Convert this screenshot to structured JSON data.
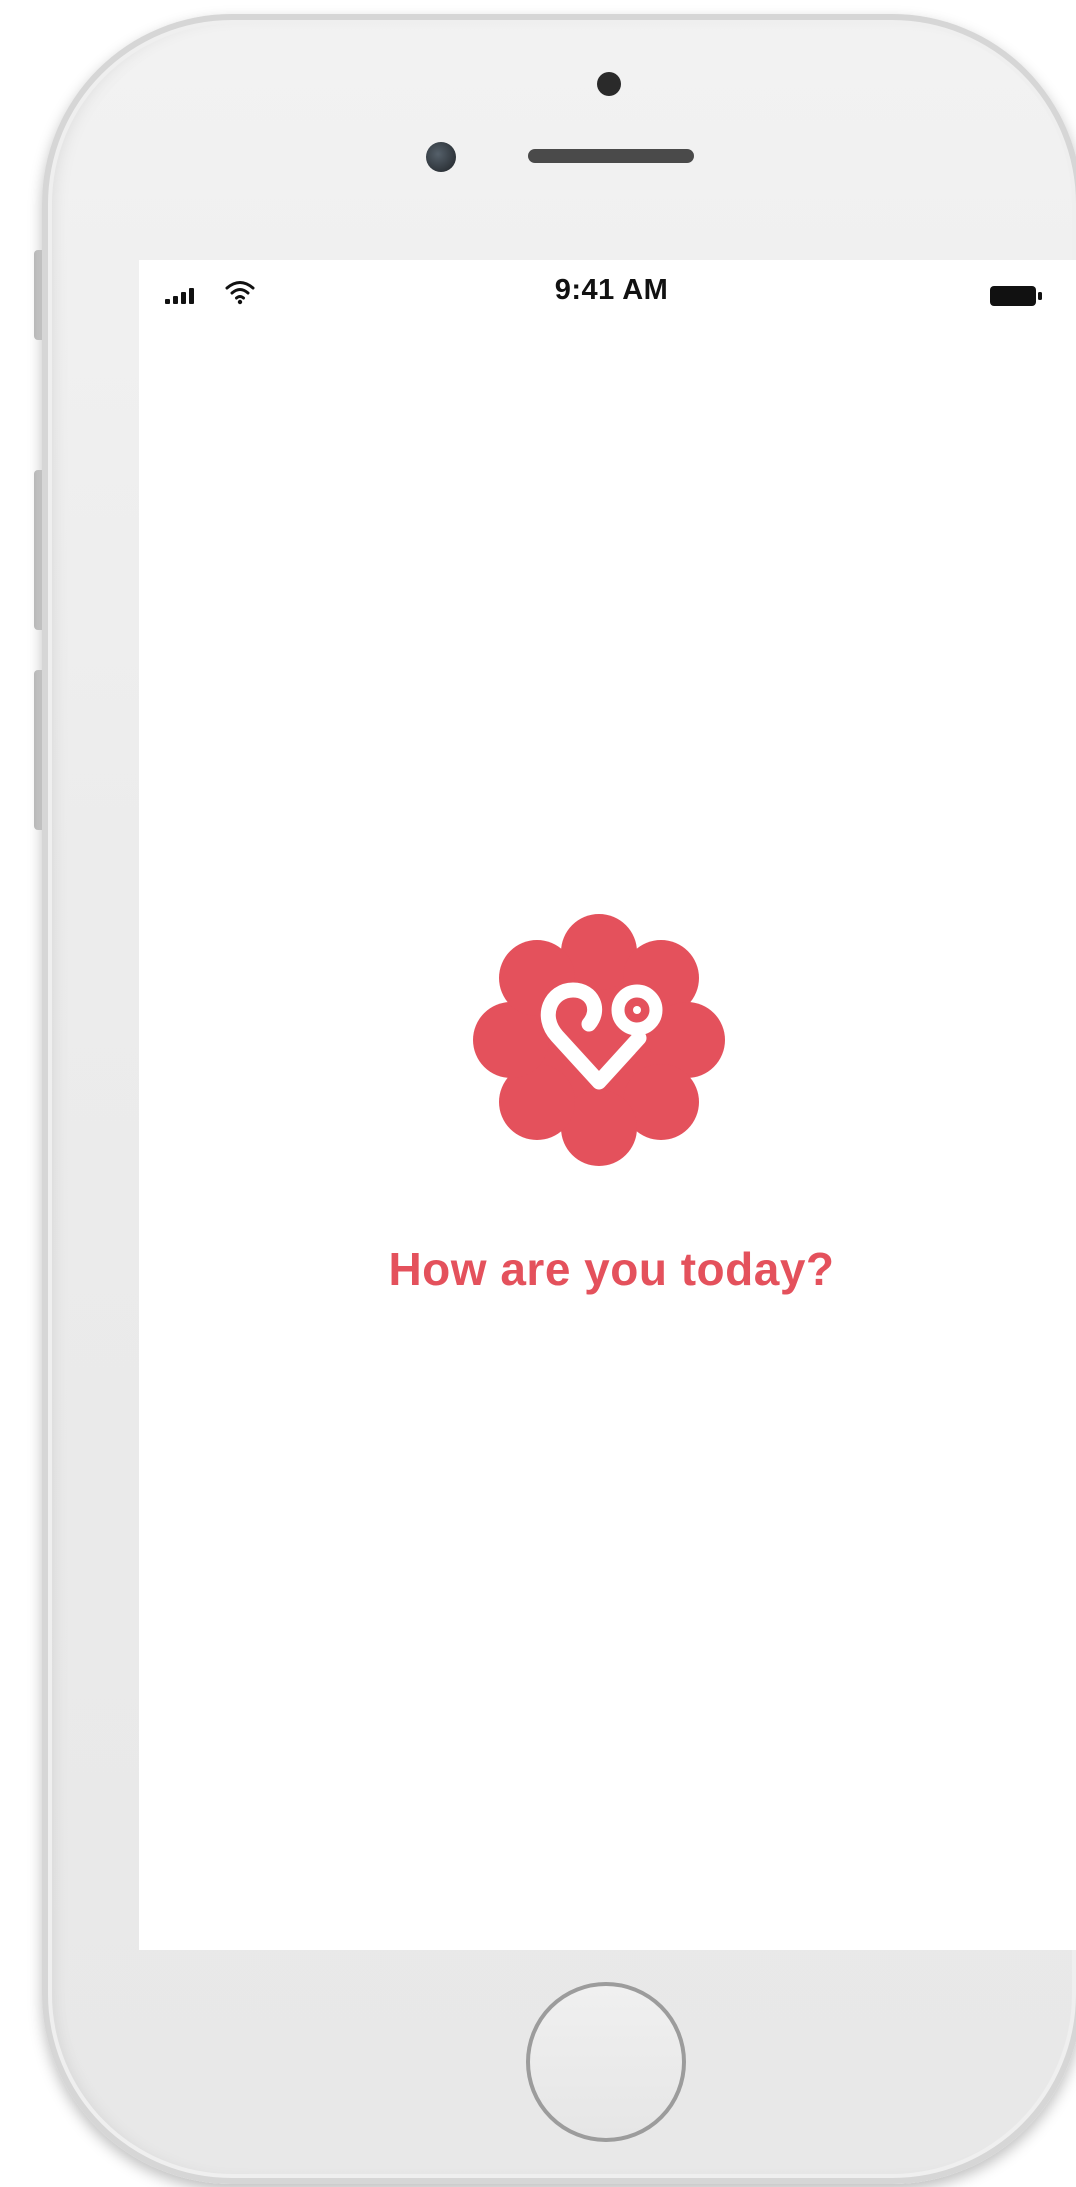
{
  "status_bar": {
    "time": "9:41 AM"
  },
  "main": {
    "logo_icon": "heart-flower-logo-icon",
    "prompt": "How are you today?"
  },
  "colors": {
    "brand_red": "#e4515c",
    "screen_bg": "#ffffff",
    "phone_body": "#ececec"
  }
}
